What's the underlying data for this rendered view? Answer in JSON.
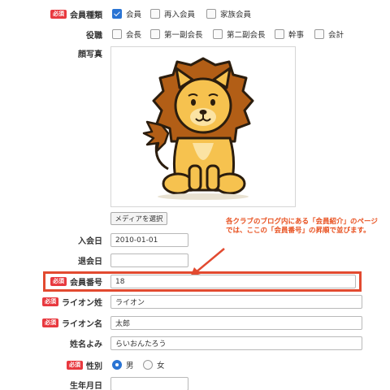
{
  "fields": {
    "member_type": {
      "label": "会員種類",
      "required": "必須",
      "options": [
        {
          "label": "会員",
          "checked": true
        },
        {
          "label": "再入会員",
          "checked": false
        },
        {
          "label": "家族会員",
          "checked": false
        }
      ]
    },
    "position": {
      "label": "役職",
      "options": [
        {
          "label": "会長",
          "checked": false
        },
        {
          "label": "第一副会長",
          "checked": false
        },
        {
          "label": "第二副会長",
          "checked": false
        },
        {
          "label": "幹事",
          "checked": false
        },
        {
          "label": "会計",
          "checked": false
        }
      ]
    },
    "photo": {
      "label": "顔写真",
      "button": "メディアを選択"
    },
    "join_date": {
      "label": "入会日",
      "value": "2010-01-01"
    },
    "leave_date": {
      "label": "退会日",
      "value": ""
    },
    "member_number": {
      "label": "会員番号",
      "required": "必須",
      "value": "18"
    },
    "last_name": {
      "label": "ライオン姓",
      "required": "必須",
      "value": "ライオン"
    },
    "first_name": {
      "label": "ライオン名",
      "required": "必須",
      "value": "太郎"
    },
    "name_kana": {
      "label": "姓名よみ",
      "value": "らいおんたろう"
    },
    "gender": {
      "label": "性別",
      "required": "必須",
      "options": [
        {
          "label": "男",
          "checked": true
        },
        {
          "label": "女",
          "checked": false
        }
      ]
    },
    "birth_date": {
      "label": "生年月日",
      "value": ""
    }
  },
  "annotation": {
    "text": "各クラブのブログ内にある「会員紹介」のページでは、ここの「会員番号」の昇順で並びます。",
    "color": "#e8501f"
  },
  "colors": {
    "accent": "#2a74d4",
    "required_badge": "#e8393f",
    "highlight_border": "#e24a30"
  }
}
